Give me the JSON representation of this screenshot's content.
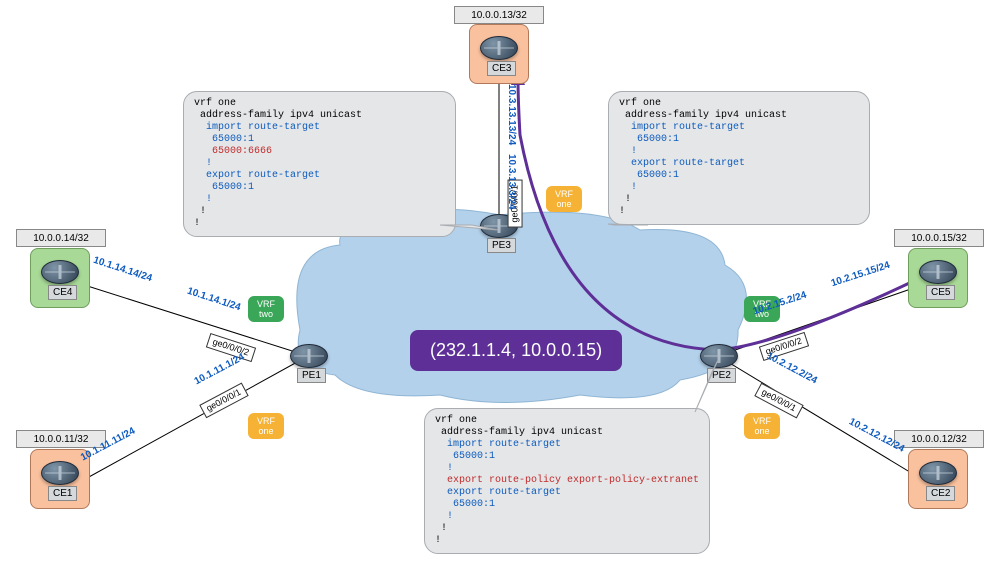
{
  "ips": {
    "ce3": "10.0.0.13/32",
    "ce4": "10.0.0.14/32",
    "ce1": "10.0.0.11/32",
    "ce5": "10.0.0.15/32",
    "ce2": "10.0.0.12/32"
  },
  "devices": {
    "ce1": "CE1",
    "ce2": "CE2",
    "ce3": "CE3",
    "ce4": "CE4",
    "ce5": "CE5",
    "pe1": "PE1",
    "pe2": "PE2",
    "pe3": "PE3"
  },
  "ifaces": {
    "pe3_up": "ge0/0/0/1",
    "pe1_g2": "ge0/0/0/2",
    "pe1_g1": "ge0/0/0/1",
    "pe2_g2": "ge0/0/0/2",
    "pe2_g1": "ge0/0/0/1"
  },
  "vrf": {
    "one": "VRF\none",
    "two": "VRF\ntwo"
  },
  "subnets": {
    "ce3_out": "10.3.13.13/24",
    "pe3_in": "10.3.13.3/24",
    "ce4_out": "10.1.14.14/24",
    "pe1_top": "10.1.14.1/24",
    "pe1_bot": "10.1.11.1/24",
    "ce1_out": "10.1.11.11/24",
    "ce5_out": "10.2.15.15/24",
    "pe2_top": "10.2.15.2/24",
    "pe2_bot": "10.2.12.2/24",
    "ce2_out": "10.2.12.12/24"
  },
  "mcast": "(232.1.1.4, 10.0.0.15)",
  "config": {
    "pe3": {
      "l1": "vrf one",
      "l2": " address-family ipv4 unicast",
      "l3": "  import route-target",
      "l4": "   65000:1",
      "l5": "   65000:6666",
      "l6": "  !",
      "l7": "  export route-target",
      "l8": "   65000:1",
      "l9": "  !",
      "l10": " !",
      "l11": "!"
    },
    "pe2top": {
      "l1": "vrf one",
      "l2": " address-family ipv4 unicast",
      "l3": "  import route-target",
      "l4": "   65000:1",
      "l5": "  !",
      "l6": "  export route-target",
      "l7": "   65000:1",
      "l8": "  !",
      "l9": " !",
      "l10": "!"
    },
    "pe2bot": {
      "l1": "vrf one",
      "l2": " address-family ipv4 unicast",
      "l3": "  import route-target",
      "l4": "   65000:1",
      "l5": "  !",
      "l6": "  export route-policy export-policy-extranet",
      "l7": "  export route-target",
      "l8": "   65000:1",
      "l9": "  !",
      "l10": " !",
      "l11": "!"
    }
  }
}
